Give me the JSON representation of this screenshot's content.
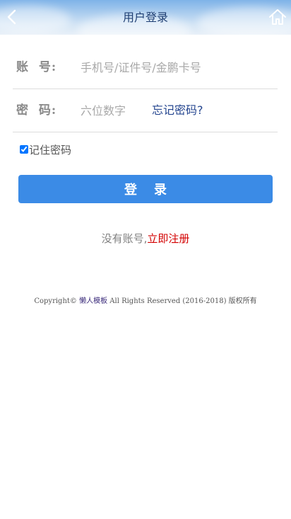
{
  "header": {
    "title": "用户登录",
    "back_icon": "chevron-left-icon",
    "home_icon": "home-icon"
  },
  "form": {
    "account": {
      "label": "账  号:",
      "placeholder": "手机号/证件号/金鹏卡号",
      "value": ""
    },
    "password": {
      "label": "密  码:",
      "placeholder": "六位数字",
      "value": "",
      "forgot_label": "忘记密码?"
    },
    "remember": {
      "label": "记住密码",
      "checked": true
    },
    "submit_label": "登录"
  },
  "register": {
    "prompt": "没有账号,",
    "link_label": "立即注册"
  },
  "footer": {
    "prefix": "Copyright© ",
    "link_label": "懒人模板",
    "suffix": " All Rights Reserved (2016-2018) 版权所有"
  },
  "colors": {
    "primary_button": "#3b8be6",
    "link_blue": "#24458f",
    "register_red": "#d30000"
  }
}
